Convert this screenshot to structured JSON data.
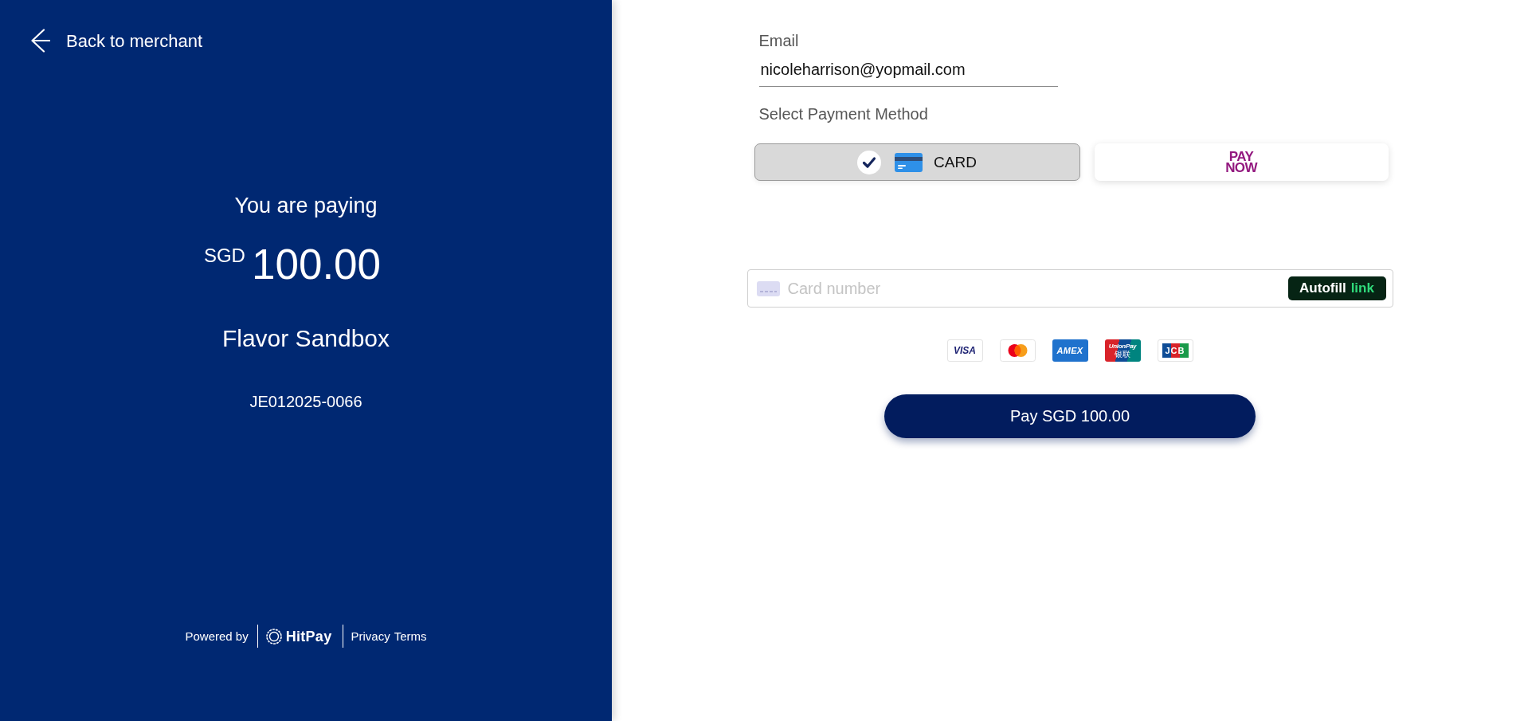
{
  "back_link": {
    "label": "Back to merchant"
  },
  "summary": {
    "heading": "You are paying",
    "currency": "SGD",
    "amount": "100.00",
    "merchant": "Flavor Sandbox",
    "reference": "JE012025-0066"
  },
  "footer": {
    "powered_by": "Powered by",
    "brand": "HitPay",
    "links": [
      "Privacy",
      "Terms"
    ]
  },
  "email": {
    "label": "Email",
    "value": "nicoleharrison@yopmail.com"
  },
  "payment_method": {
    "label": "Select Payment Method",
    "options": [
      {
        "kind": "card",
        "label": "CARD",
        "selected": true
      },
      {
        "kind": "paynow",
        "label": "PAY NOW",
        "selected": false
      }
    ]
  },
  "card_number": {
    "placeholder": "Card number",
    "autofill": {
      "label": "Autofill",
      "brand": "link"
    }
  },
  "card_brands": [
    {
      "kind": "visa",
      "label": "VISA"
    },
    {
      "kind": "mastercard"
    },
    {
      "kind": "amex",
      "label": "AMEX"
    },
    {
      "kind": "unionpay",
      "label": "UnionPay",
      "sublabel": "银联"
    },
    {
      "kind": "jcb",
      "label": "JCB"
    }
  ],
  "pay_button": {
    "label": "Pay SGD 100.00"
  }
}
